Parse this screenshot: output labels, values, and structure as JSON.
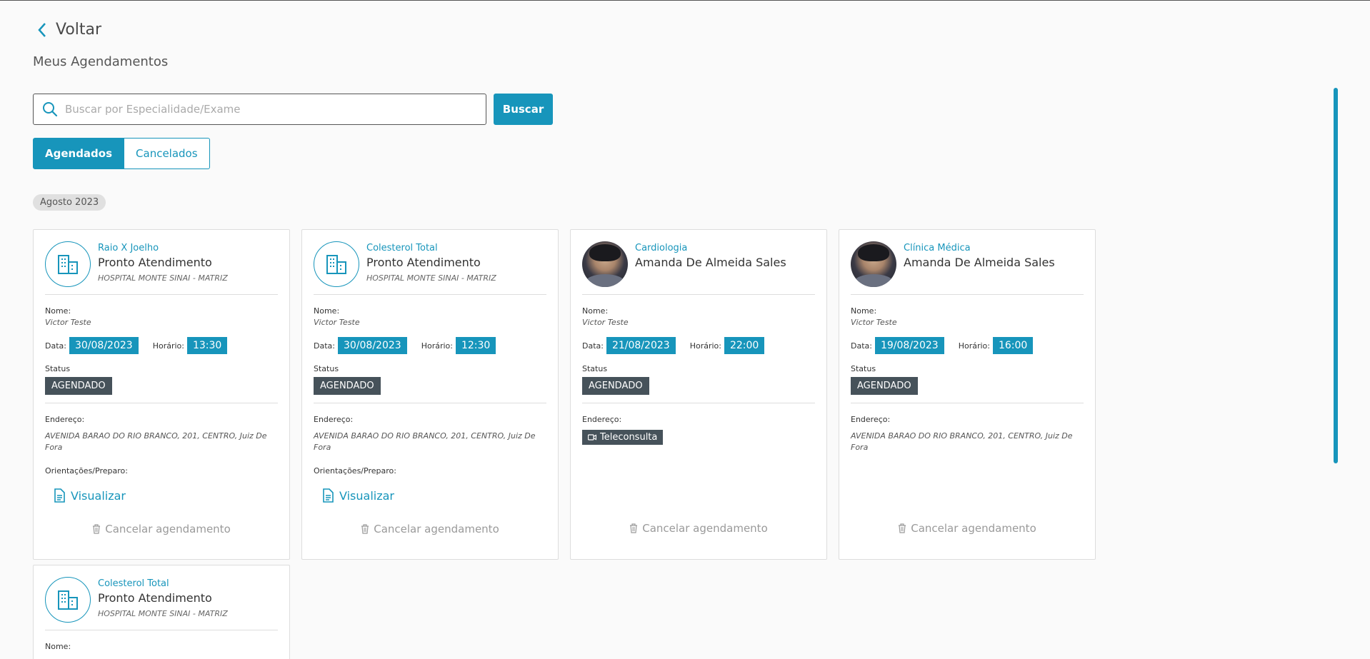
{
  "nav": {
    "back_label": "Voltar"
  },
  "page": {
    "title": "Meus Agendamentos"
  },
  "search": {
    "placeholder": "Buscar por Especialidade/Exame",
    "value": "",
    "button_label": "Buscar"
  },
  "tabs": [
    {
      "label": "Agendados",
      "active": true
    },
    {
      "label": "Cancelados",
      "active": false
    }
  ],
  "month_label": "Agosto 2023",
  "labels": {
    "nome": "Nome:",
    "data": "Data:",
    "horario": "Horário:",
    "status": "Status",
    "endereco": "Endereço:",
    "orientacoes": "Orientações/Preparo:",
    "visualizar": "Visualizar",
    "cancelar": "Cancelar agendamento"
  },
  "appointments": [
    {
      "specialty": "Raio X Joelho",
      "place": "Pronto Atendimento",
      "hospital": "HOSPITAL MONTE SINAI - MATRIZ",
      "nome": "Victor Teste",
      "data": "30/08/2023",
      "horario": "13:30",
      "status": "AGENDADO",
      "endereco": "AVENIDA BARAO DO RIO BRANCO, 201, CENTRO, Juiz De Fora",
      "icon": "building-icon"
    },
    {
      "specialty": "Colesterol Total",
      "place": "Pronto Atendimento",
      "hospital": "HOSPITAL MONTE SINAI - MATRIZ",
      "nome": "Victor Teste",
      "data": "30/08/2023",
      "horario": "12:30",
      "status": "AGENDADO",
      "endereco": "AVENIDA BARAO DO RIO BRANCO, 201, CENTRO, Juiz De Fora",
      "icon": "building-icon"
    },
    {
      "specialty": "Cardiologia",
      "place": "Amanda De Almeida Sales",
      "hospital": "",
      "nome": "Victor Teste",
      "data": "21/08/2023",
      "horario": "22:00",
      "status": "AGENDADO",
      "endereco": "Teleconsulta",
      "icon": "doctor-avatar"
    },
    {
      "specialty": "Clínica Médica",
      "place": "Amanda De Almeida Sales",
      "hospital": "",
      "nome": "Victor Teste",
      "data": "19/08/2023",
      "horario": "16:00",
      "status": "AGENDADO",
      "endereco": "AVENIDA BARAO DO RIO BRANCO, 201, CENTRO, Juiz De Fora",
      "icon": "doctor-avatar"
    },
    {
      "specialty": "Colesterol Total",
      "place": "Pronto Atendimento",
      "hospital": "HOSPITAL MONTE SINAI - MATRIZ",
      "icon": "building-icon"
    }
  ],
  "colors": {
    "accent": "#1795bb",
    "status_bg": "#46525a"
  }
}
